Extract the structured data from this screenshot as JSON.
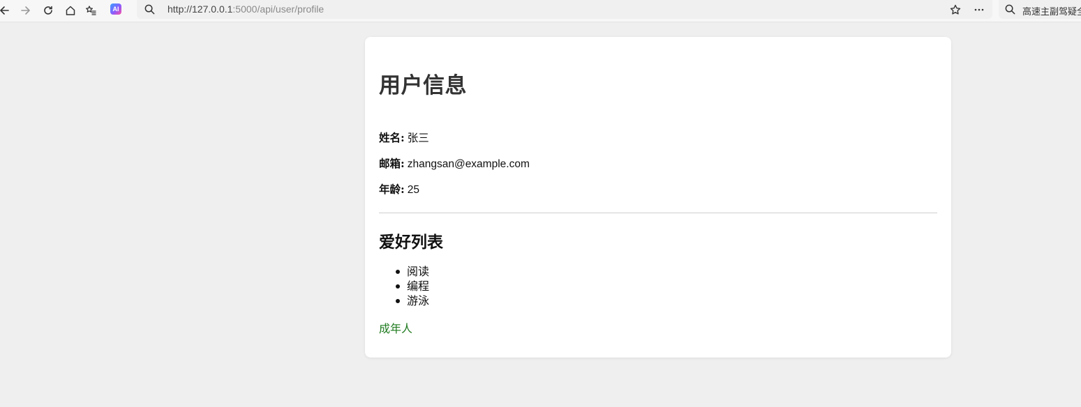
{
  "browser": {
    "url_host": "http://127.0.0.1",
    "url_rest": ":5000/api/user/profile",
    "ai_badge": "AI",
    "search_box_text": "高速主副驾疑全"
  },
  "icons": {
    "back": "back-arrow-icon",
    "forward": "forward-arrow-icon",
    "reload": "reload-icon",
    "home": "home-icon",
    "favorites": "favorites-icon",
    "ai": "ai-assistant-icon",
    "search": "search-icon",
    "star": "star-icon",
    "more": "more-icon"
  },
  "profile": {
    "title": "用户信息",
    "name_label": "姓名:",
    "name_value": "张三",
    "email_label": "邮箱:",
    "email_value": "zhangsan@example.com",
    "age_label": "年龄:",
    "age_value": "25"
  },
  "hobbies": {
    "title": "爱好列表",
    "items": [
      "阅读",
      "编程",
      "游泳"
    ]
  },
  "status": {
    "text": "成年人",
    "color": "#1e7a1e"
  },
  "colors": {
    "page_bg": "#efefef",
    "card_bg": "#ffffff",
    "title_color": "#333333"
  }
}
